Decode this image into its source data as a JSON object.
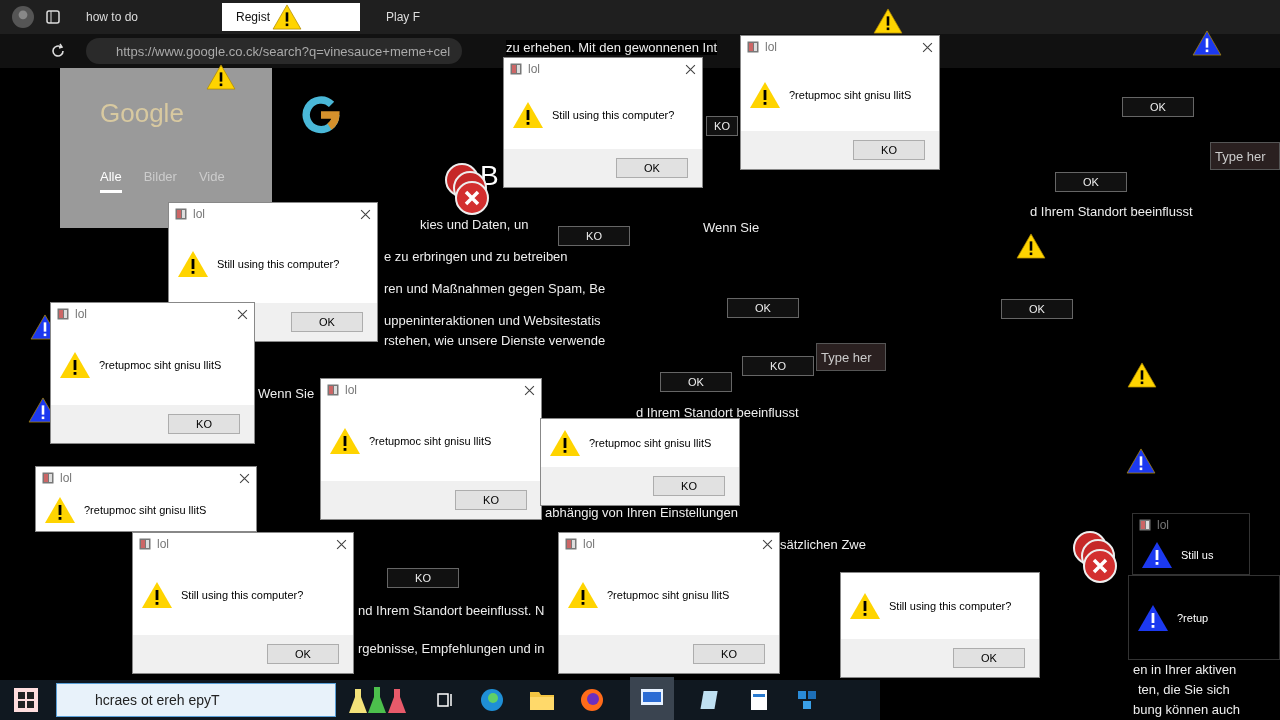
{
  "browser": {
    "tabs": [
      {
        "label": "how to do",
        "selected": false
      },
      {
        "label": "Regist",
        "selected": true
      },
      {
        "label": "Play F",
        "selected": false
      }
    ],
    "url": "https://www.google.co.ck/search?q=vinesauce+meme+cel",
    "google_logo": "Google",
    "nav": [
      {
        "label": "Alle",
        "selected": true
      },
      {
        "label": "Bilder",
        "selected": false
      },
      {
        "label": "Vide",
        "selected": false
      }
    ],
    "big_letter": "B",
    "page_lines": [
      "zu erheben. Mit den gewonnenen Int",
      "e zu erbringen und zu betreiben",
      "ren und Maßnahmen gegen Spam, Be",
      "uppeninteraktionen und Websitestatis",
      "rstehen, wie unsere Dienste verwende",
      "abhängig von Ihren Einstellungen",
      "sätzlichen Zwe",
      "nd Ihrem Standort beeinflusst. N",
      "rgebnisse, Empfehlungen und in",
      "d Ihrem Standort beeinflusst",
      "d Ihrem Standort beeinflusst",
      "Wenn Sie",
      "Wenn Sie",
      "en in Ihrer aktiven",
      "ten, die Sie sich",
      "bung können auch",
      "kies und Daten, un"
    ]
  },
  "dialogs": [
    {
      "kind": "light",
      "title": "lol",
      "message": "Still using this computer?",
      "button": "OK"
    },
    {
      "kind": "light",
      "title": "lol",
      "message": "?retupmoc siht gnisu llitS",
      "button": "KO"
    },
    {
      "kind": "light",
      "title": "lol",
      "message": "Still using this computer?",
      "button": "OK"
    },
    {
      "kind": "light",
      "title": "lol",
      "message": "?retupmoc siht gnisu llitS",
      "button": "KO"
    },
    {
      "kind": "light",
      "title": "lol",
      "message": "?retupmoc siht gnisu llitS",
      "button": "KO"
    },
    {
      "kind": "light",
      "title": "lol",
      "message": "?retupmoc siht gnisu llitS"
    },
    {
      "kind": "light",
      "message": "?retupmoc siht gnisu llitS",
      "button": "KO"
    },
    {
      "kind": "light",
      "title": "lol",
      "message": "Still using this computer?",
      "button": "OK"
    },
    {
      "kind": "light",
      "title": "lol",
      "message": "?retupmoc siht gnisu llitS",
      "button": "KO"
    },
    {
      "kind": "light",
      "message": "Still using this computer?",
      "button": "OK"
    },
    {
      "kind": "dark",
      "title": "lol",
      "message": "Still us"
    },
    {
      "kind": "dark",
      "message": "?retup"
    }
  ],
  "stray_buttons": [
    "OK",
    "OK",
    "KO",
    "OK",
    "OK",
    "OK",
    "KO",
    "KO",
    "KO"
  ],
  "type_fields": [
    {
      "placeholder": "Type her"
    },
    {
      "placeholder": "Type her"
    }
  ],
  "taskbar": {
    "search": {
      "placeholder": "hcraes ot ereh epyT"
    }
  }
}
